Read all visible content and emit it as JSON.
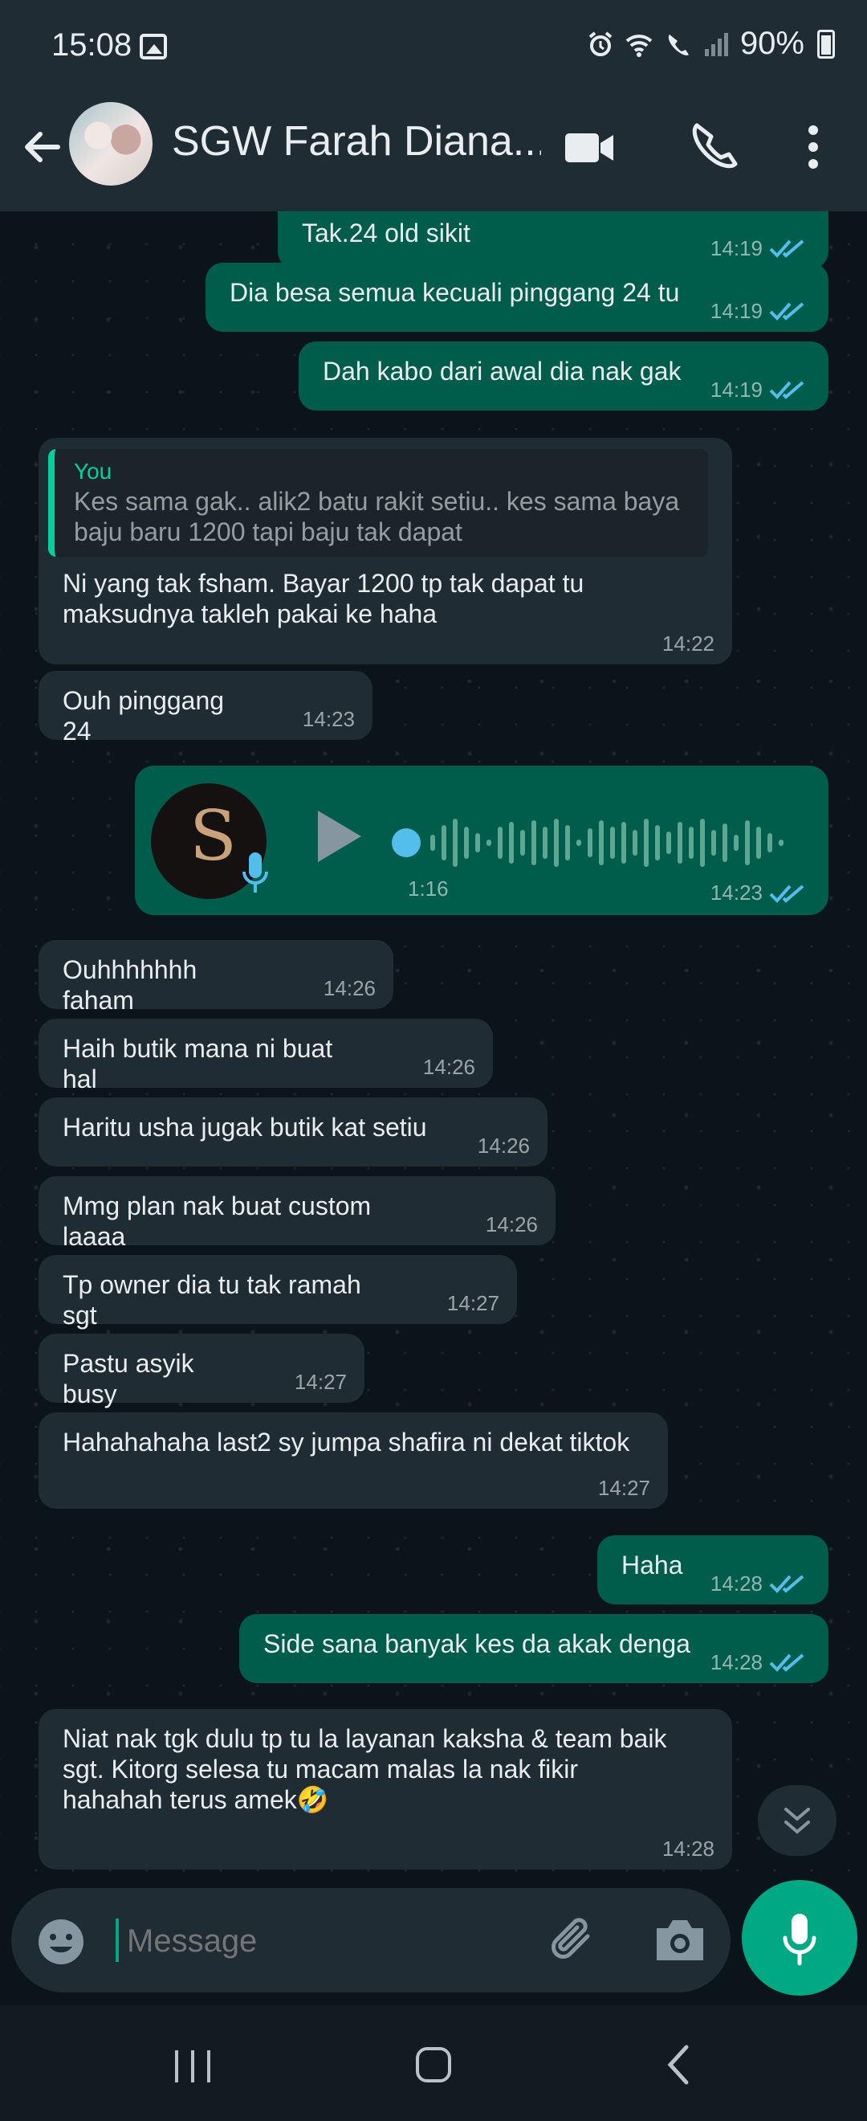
{
  "status_bar": {
    "time": "15:08",
    "battery": "90%"
  },
  "contact": {
    "name": "SGW Farah Diana..."
  },
  "messages": [
    {
      "text": "Tak.24 old sikit",
      "time": "14:19"
    },
    {
      "text": "Dia besa semua kecuali pinggang 24 tu",
      "time": "14:19"
    },
    {
      "text": "Dah kabo dari awal dia nak gak",
      "time": "14:19"
    },
    {
      "quote_author": "You",
      "quote_text": "Kes sama gak.. alik2 batu rakit setiu.. kes sama baya baju baru 1200 tapi baju tak dapat",
      "text": "Ni yang tak fsham. Bayar 1200 tp tak dapat tu maksudnya takleh pakai ke haha",
      "time": "14:22"
    },
    {
      "text": "Ouh pinggang 24",
      "time": "14:23"
    },
    {
      "duration": "1:16",
      "time": "14:23"
    },
    {
      "text": "Ouhhhhhhh faham",
      "time": "14:26"
    },
    {
      "text": "Haih butik mana ni buat hal",
      "time": "14:26"
    },
    {
      "text": "Haritu usha jugak butik kat setiu",
      "time": "14:26"
    },
    {
      "text": "Mmg plan nak buat custom laaaa",
      "time": "14:26"
    },
    {
      "text": "Tp owner dia tu tak ramah sgt",
      "time": "14:27"
    },
    {
      "text": "Pastu asyik busy",
      "time": "14:27"
    },
    {
      "text": "Hahahahaha last2 sy jumpa shafira ni dekat tiktok",
      "time": "14:27"
    },
    {
      "text": "Haha",
      "time": "14:28"
    },
    {
      "text": "Side sana banyak kes da akak denga",
      "time": "14:28"
    },
    {
      "text": "Niat nak tgk dulu tp tu la layanan kaksha & team baik sgt. Kitorg selesa tu macam malas la nak fikir hahahah terus amek🤣",
      "time": "14:28"
    }
  ],
  "composer": {
    "placeholder": "Message"
  },
  "colors": {
    "incoming": "#202c33",
    "outgoing": "#005c4b",
    "accent": "#00a884",
    "read_ticks": "#53bdeb"
  }
}
